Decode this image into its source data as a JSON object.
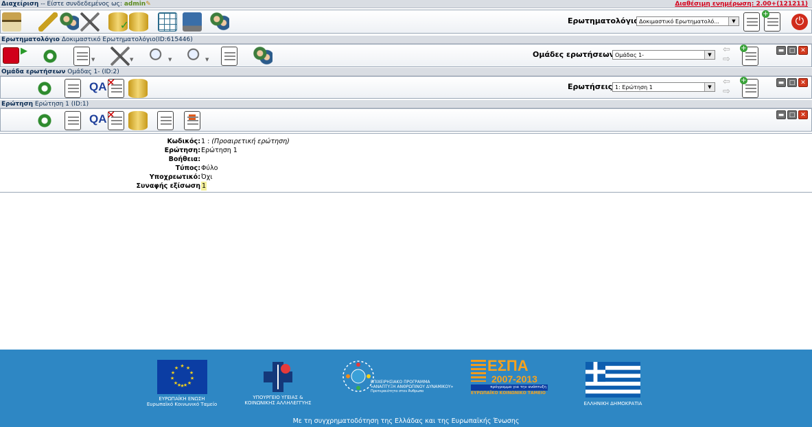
{
  "admin_bar": {
    "title": "Διαχείριση",
    "logged_in_text": " -- Είστε συνδεδεμένος ως:",
    "user": "admin",
    "update_text": "Διαθέσιμη ενημέρωση: 2.00+(121211)"
  },
  "questionnaires_select": {
    "label": "Ερωτηματολόγια:",
    "value": "Δοκιμαστικό Ερωτηματολό..."
  },
  "questionnaire_bar": {
    "title": "Ερωτηματολόγιο",
    "subtitle": "Δοκιμαστικό Ερωτηματολόγιο(ID:615446)"
  },
  "groups_select": {
    "label": "Ομάδες ερωτήσεων:",
    "value": "Ομάδας 1-"
  },
  "group_bar": {
    "title": "Ομάδα ερωτήσεων",
    "subtitle": "Ομάδας 1- (ID:2)"
  },
  "questions_select": {
    "label": "Ερωτήσεις:",
    "value": "1: Ερώτηση 1"
  },
  "question_bar": {
    "title": "Ερώτηση",
    "subtitle": "Ερώτηση 1 (ID:1)"
  },
  "qa_label": "QA",
  "details": {
    "code_label": "Κωδικός:",
    "code_value": "1 : ",
    "code_note": "(Προαιρετική ερώτηση)",
    "question_label": "Ερώτηση:",
    "question_value": "Ερώτηση 1",
    "help_label": "Βοήθεια:",
    "help_value": "",
    "type_label": "Τύπος:",
    "type_value": "Φύλο",
    "mandatory_label": "Υποχρεωτικό:",
    "mandatory_value": "Όχι",
    "equation_label": "Συναφής εξίσωση",
    "equation_value": "1"
  },
  "footer": {
    "eu_line1": "ΕΥΡΩΠΑΪΚΗ ΕΝΩΣΗ",
    "eu_line2": "Ευρωπαϊκό Κοινωνικό Ταμείο",
    "ministry_line1": "ΥΠΟΥΡΓΕΙΟ ΥΓΕΙΑΣ &",
    "ministry_line2": "ΚΟΙΝΩΝΙΚΗΣ ΑΛΛΗΛΕΓΓΥΗΣ",
    "program_line1": "ΕΠΙΧΕΙΡΗΣΙΑΚΟ ΠΡΟΓΡΑΜΜΑ",
    "program_line2": "«ΑΝΑΠΤΥΞΗ ΑΝΘΡΩΠΙΝΟΥ ΔΥΝΑΜΙΚΟΥ»",
    "program_line3": "Προτεραιότητα στον Άνθρωπο",
    "espa_logo": "ΕΣΠΑ",
    "espa_years": "2007-2013",
    "espa_line1": "πρόγραμμα για την ανάπτυξη",
    "espa_line2": "ΕΥΡΩΠΑΪΚΟ ΚΟΙΝΩΝΙΚΟ ΤΑΜΕΙΟ",
    "greece": "ΕΛΛΗΝΙΚΗ ΔΗΜΟΚΡΑΤΙΑ",
    "cofunding": "Με τη συγχρηματοδότηση της Ελλάδας και της Ευρωπαϊκής Ένωσης"
  }
}
